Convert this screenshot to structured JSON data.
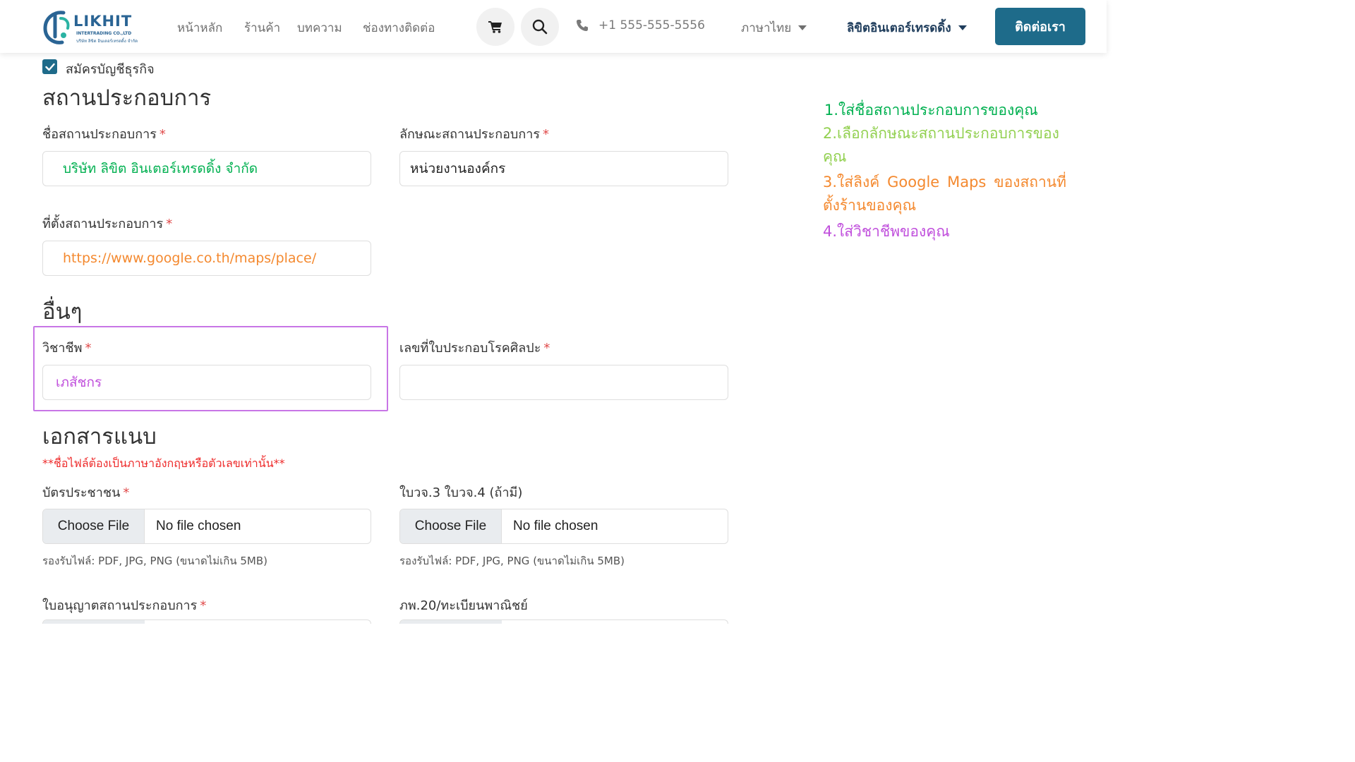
{
  "header": {
    "logo": {
      "name": "LIKHIT",
      "sub": "INTERTRADING CO.,LTD",
      "sub_thai": "บริษัท ลิขิต อินเตอร์เทรดดิ้ง จำกัด"
    },
    "nav": [
      "หน้าหลัก",
      "ร้านค้า",
      "บทความ",
      "ช่องทางติดต่อ"
    ],
    "cart_icon": "cart-icon",
    "search_icon": "search-icon",
    "phone": "+1 555-555-5556",
    "language": "ภาษาไทย",
    "account": "ลิขิตอินเตอร์เทรดดิ้ง",
    "contact_button": "ติดต่อเรา"
  },
  "form": {
    "business_checkbox": {
      "checked": true,
      "label": "สมัครบัญชีธุรกิจ"
    },
    "business_section": {
      "title": "สถานประกอบการ",
      "name_label": "ชื่อสถานประกอบการ",
      "name_value": "บริษัท ลิขิต อินเตอร์เทรดดิ้ง จำกัด",
      "type_label": "ลักษณะสถานประกอบการ",
      "type_value": "หน่วยงานองค์กร",
      "location_label": "ที่ตั้งสถานประกอบการ",
      "location_value": "https://www.google.co.th/maps/place/"
    },
    "other_section": {
      "title": "อื่นๆ",
      "profession_label": "วิชาชีพ",
      "profession_value": "เภสัชกร",
      "license_label": "เลขที่ใบประกอบโรคศิลปะ",
      "license_value": ""
    },
    "attachments_section": {
      "title": "เอกสารแนบ",
      "warning": "**ชื่อไฟล์ต้องเป็นภาษาอังกฤษหรือตัวเลขเท่านั้น**",
      "id_card_label": "บัตรประชาชน",
      "tax_doc_label": "ใบวจ.3 ใบวจ.4 (ถ้ามี)",
      "choose_file": "Choose File",
      "no_file": "No file chosen",
      "hint": "รองรับไฟล์: PDF, JPG, PNG (ขนาดไม่เกิน 5MB)",
      "permit_label": "ใบอนุญาตสถานประกอบการ",
      "commerce_label": "ภพ.20/ทะเบียนพาณิชย์"
    },
    "required_mark": "*"
  },
  "instructions": [
    {
      "text": "1.ใส่ชื่อสถานประกอบการของคุณ",
      "color": "#00b050"
    },
    {
      "text": "2.เลือกลักษณะสถานประกอบการของคุณ",
      "color": "#92d050"
    },
    {
      "text": "3.ใส่ลิงค์ Google Maps ของสถานที่ตั้งร้านของคุณ",
      "color": "#f4892f"
    },
    {
      "text": "4.ใส่วิชาชีพของคุณ",
      "color": "#c04fdc"
    }
  ],
  "colors": {
    "brand": "#1e6b8a",
    "name_value": "#00b050",
    "location_value": "#f4892f",
    "profession_value": "#c04fdc",
    "highlight": "#c876e6",
    "warning": "#ee2b2b",
    "required": "#e04a4a"
  }
}
